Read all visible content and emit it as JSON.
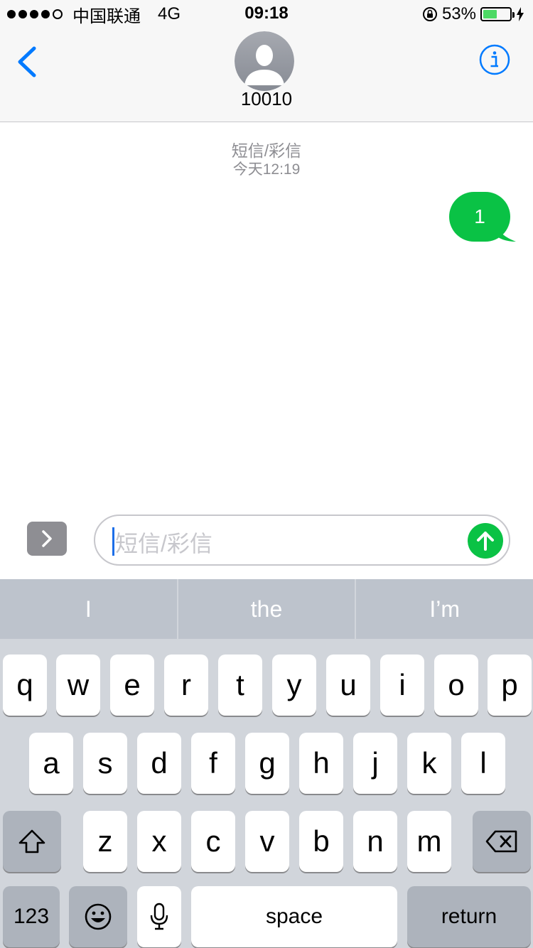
{
  "status_bar": {
    "carrier": "中国联通",
    "network": "4G",
    "time": "09:18",
    "battery_percent": "53%",
    "battery_level": 0.53,
    "signal_bars_filled": 4,
    "signal_bars_total": 5
  },
  "header": {
    "contact_name": "10010"
  },
  "conversation": {
    "message_type": "短信/彩信",
    "timestamp": "今天12:19",
    "messages": [
      {
        "text": "1",
        "direction": "sent"
      }
    ]
  },
  "composer": {
    "placeholder": "短信/彩信"
  },
  "keyboard": {
    "suggestions": [
      "I",
      "the",
      "I’m"
    ],
    "row1": [
      "q",
      "w",
      "e",
      "r",
      "t",
      "y",
      "u",
      "i",
      "o",
      "p"
    ],
    "row2": [
      "a",
      "s",
      "d",
      "f",
      "g",
      "h",
      "j",
      "k",
      "l"
    ],
    "row3": [
      "z",
      "x",
      "c",
      "v",
      "b",
      "n",
      "m"
    ],
    "numbers_label": "123",
    "space_label": "space",
    "return_label": "return"
  },
  "colors": {
    "accent": "#007aff",
    "bubble_green": "#0ac245",
    "battery_green": "#4cd964"
  }
}
